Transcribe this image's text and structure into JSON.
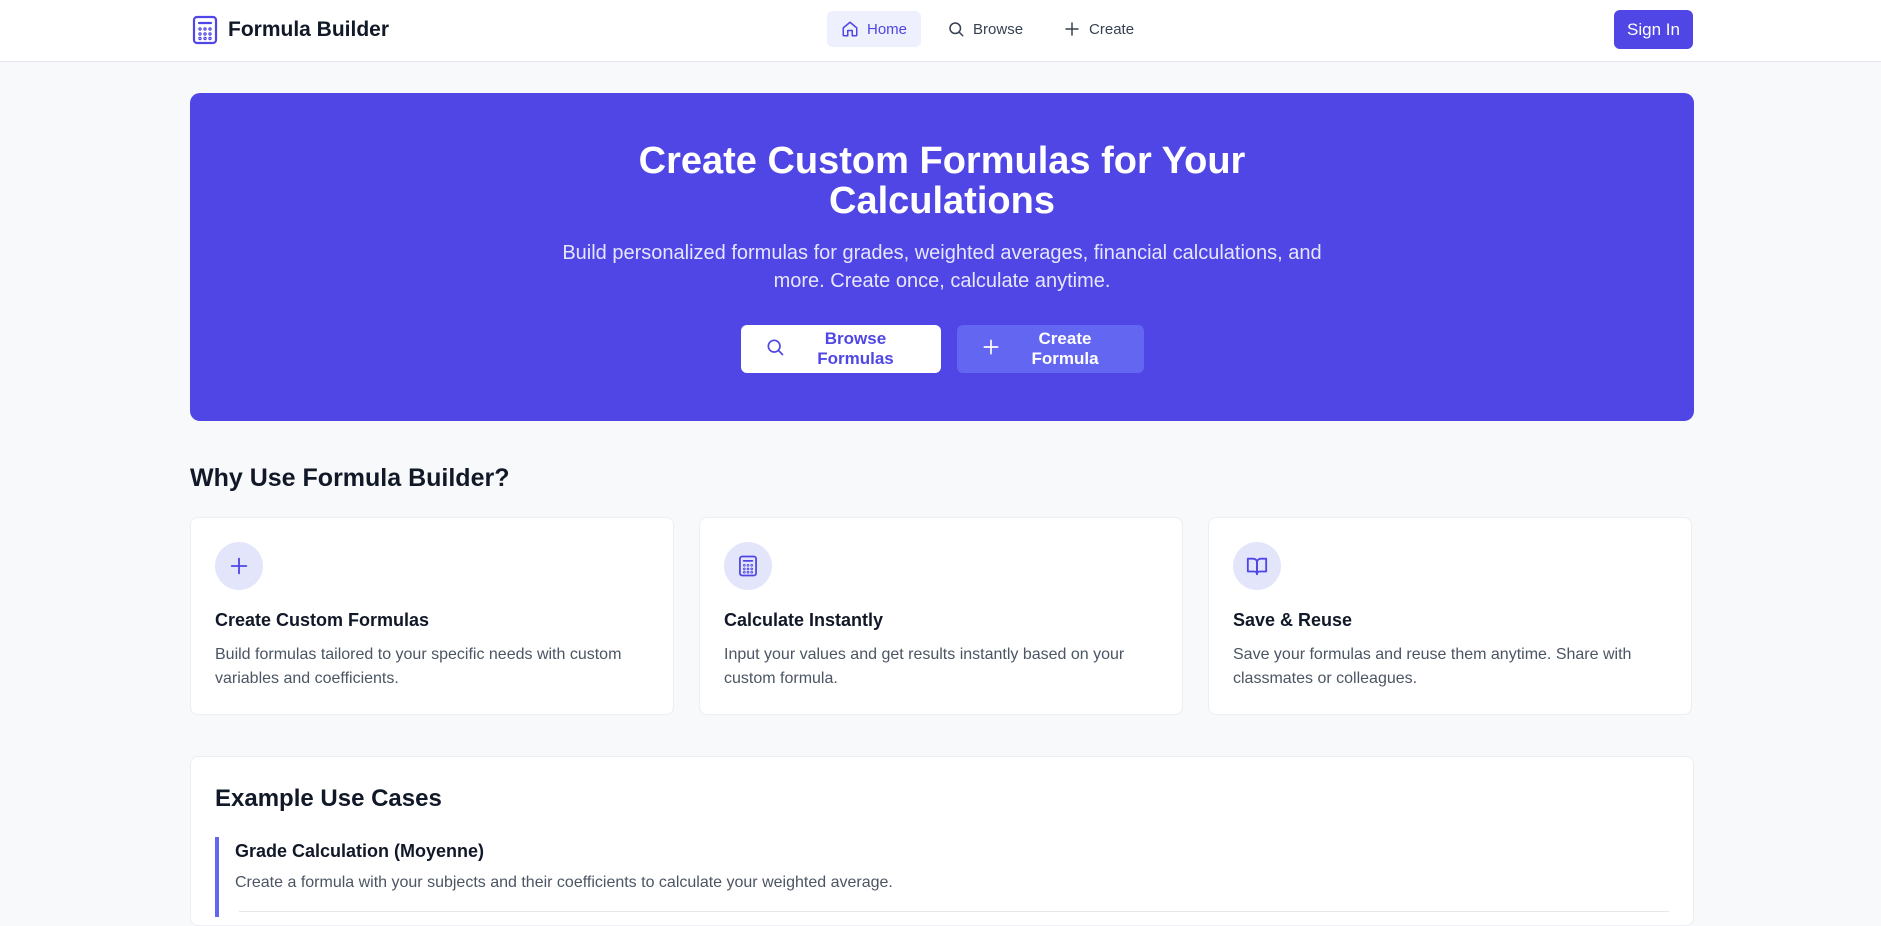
{
  "header": {
    "brand": "Formula Builder",
    "nav": [
      {
        "label": "Home",
        "icon": "home-icon",
        "active": true
      },
      {
        "label": "Browse",
        "icon": "search-icon"
      },
      {
        "label": "Create",
        "icon": "plus-icon"
      }
    ],
    "signin_label": "Sign In"
  },
  "hero": {
    "title": "Create Custom Formulas for Your Calculations",
    "subtitle": "Build personalized formulas for grades, weighted averages, financial calculations, and more. Create once, calculate anytime.",
    "browse_label": "Browse Formulas",
    "create_label": "Create Formula"
  },
  "features": {
    "title": "Why Use Formula Builder?",
    "items": [
      {
        "icon": "plus-icon",
        "title": "Create Custom Formulas",
        "desc": "Build formulas tailored to your specific needs with custom variables and coefficients."
      },
      {
        "icon": "calculator-icon",
        "title": "Calculate Instantly",
        "desc": "Input your values and get results instantly based on your custom formula."
      },
      {
        "icon": "book-open-icon",
        "title": "Save & Reuse",
        "desc": "Save your formulas and reuse them anytime. Share with classmates or colleagues."
      }
    ]
  },
  "examples": {
    "title": "Example Use Cases",
    "items": [
      {
        "title": "Grade Calculation (Moyenne)",
        "desc": "Create a formula with your subjects and their coefficients to calculate your weighted average."
      }
    ]
  },
  "colors": {
    "accent": "#4f46e5",
    "accent_light": "#6366f1",
    "icon_bg": "#e3e5fb",
    "page_bg": "#f8f9fb"
  }
}
